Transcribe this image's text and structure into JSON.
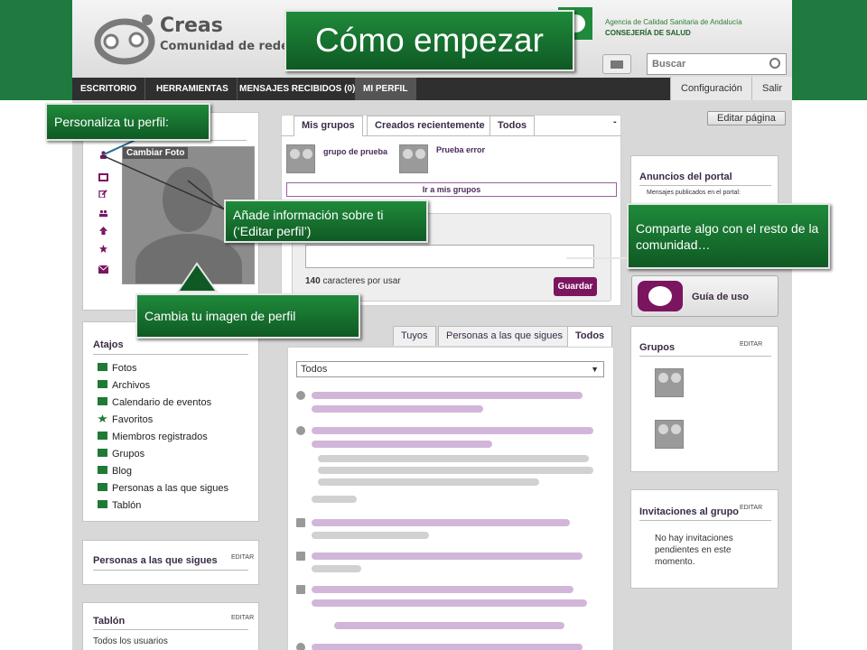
{
  "header": {
    "logo_name": "Creas",
    "logo_subtitle": "Comunidad de redes pr",
    "agency_line1": "Agencia de Calidad Sanitaria de Andalucía",
    "agency_line2": "CONSEJERÍA DE SALUD",
    "search_placeholder": "Buscar"
  },
  "nav": {
    "items": [
      "ESCRITORIO",
      "HERRAMIENTAS",
      "MENSAJES RECIBIDOS (0)",
      "MI PERFIL"
    ],
    "settings": "Configuración",
    "logout": "Salir",
    "edit_page": "Editar página"
  },
  "profile": {
    "change_photo": "Cambiar Foto"
  },
  "groups_widget": {
    "tabs": [
      "Mis grupos",
      "Creados recientemente",
      "Todos"
    ],
    "groups": [
      "grupo de prueba",
      "Prueba error"
    ],
    "link": "Ir a mis grupos"
  },
  "composer": {
    "chars_count": "140",
    "chars_label": "caracteres por usar",
    "submit": "Guardar"
  },
  "activity": {
    "tabs": [
      "Tuyos",
      "Personas a las que sigues",
      "Todos"
    ],
    "filter": "Todos",
    "items": [
      "",
      "",
      "",
      "",
      "",
      "",
      ""
    ]
  },
  "shortcuts": {
    "title": "Atajos",
    "items": [
      "Fotos",
      "Archivos",
      "Calendario de eventos",
      "Favoritos",
      "Miembros registrados",
      "Grupos",
      "Blog",
      "Personas a las que sigues",
      "Tablón"
    ]
  },
  "following": {
    "title": "Personas a las que sigues",
    "edit": "EDITAR"
  },
  "wall": {
    "title": "Tablón",
    "edit": "EDITAR",
    "filter": "Todos los usuarios"
  },
  "announcements": {
    "title": "Anuncios del portal",
    "subtitle": "Mensajes publicados en el portal:"
  },
  "guide": {
    "label": "Guía de uso"
  },
  "groups_panel": {
    "title": "Grupos",
    "edit": "EDITAR"
  },
  "invitations": {
    "title": "Invitaciones al grupo",
    "edit": "EDITAR",
    "empty": "No hay invitaciones pendientes en este momento."
  },
  "callouts": {
    "title": "Cómo empezar",
    "personaliza": "Personaliza tu perfil:",
    "anade": "Añade información sobre ti (‘Editar perfil’)",
    "cambia": "Cambia tu imagen de perfil",
    "comparte": "Comparte algo con el resto de la comunidad…"
  },
  "colors": {
    "brand_green": "#1e7a3f",
    "accent_purple": "#7b1560",
    "callout_green": "#1a7a35"
  }
}
